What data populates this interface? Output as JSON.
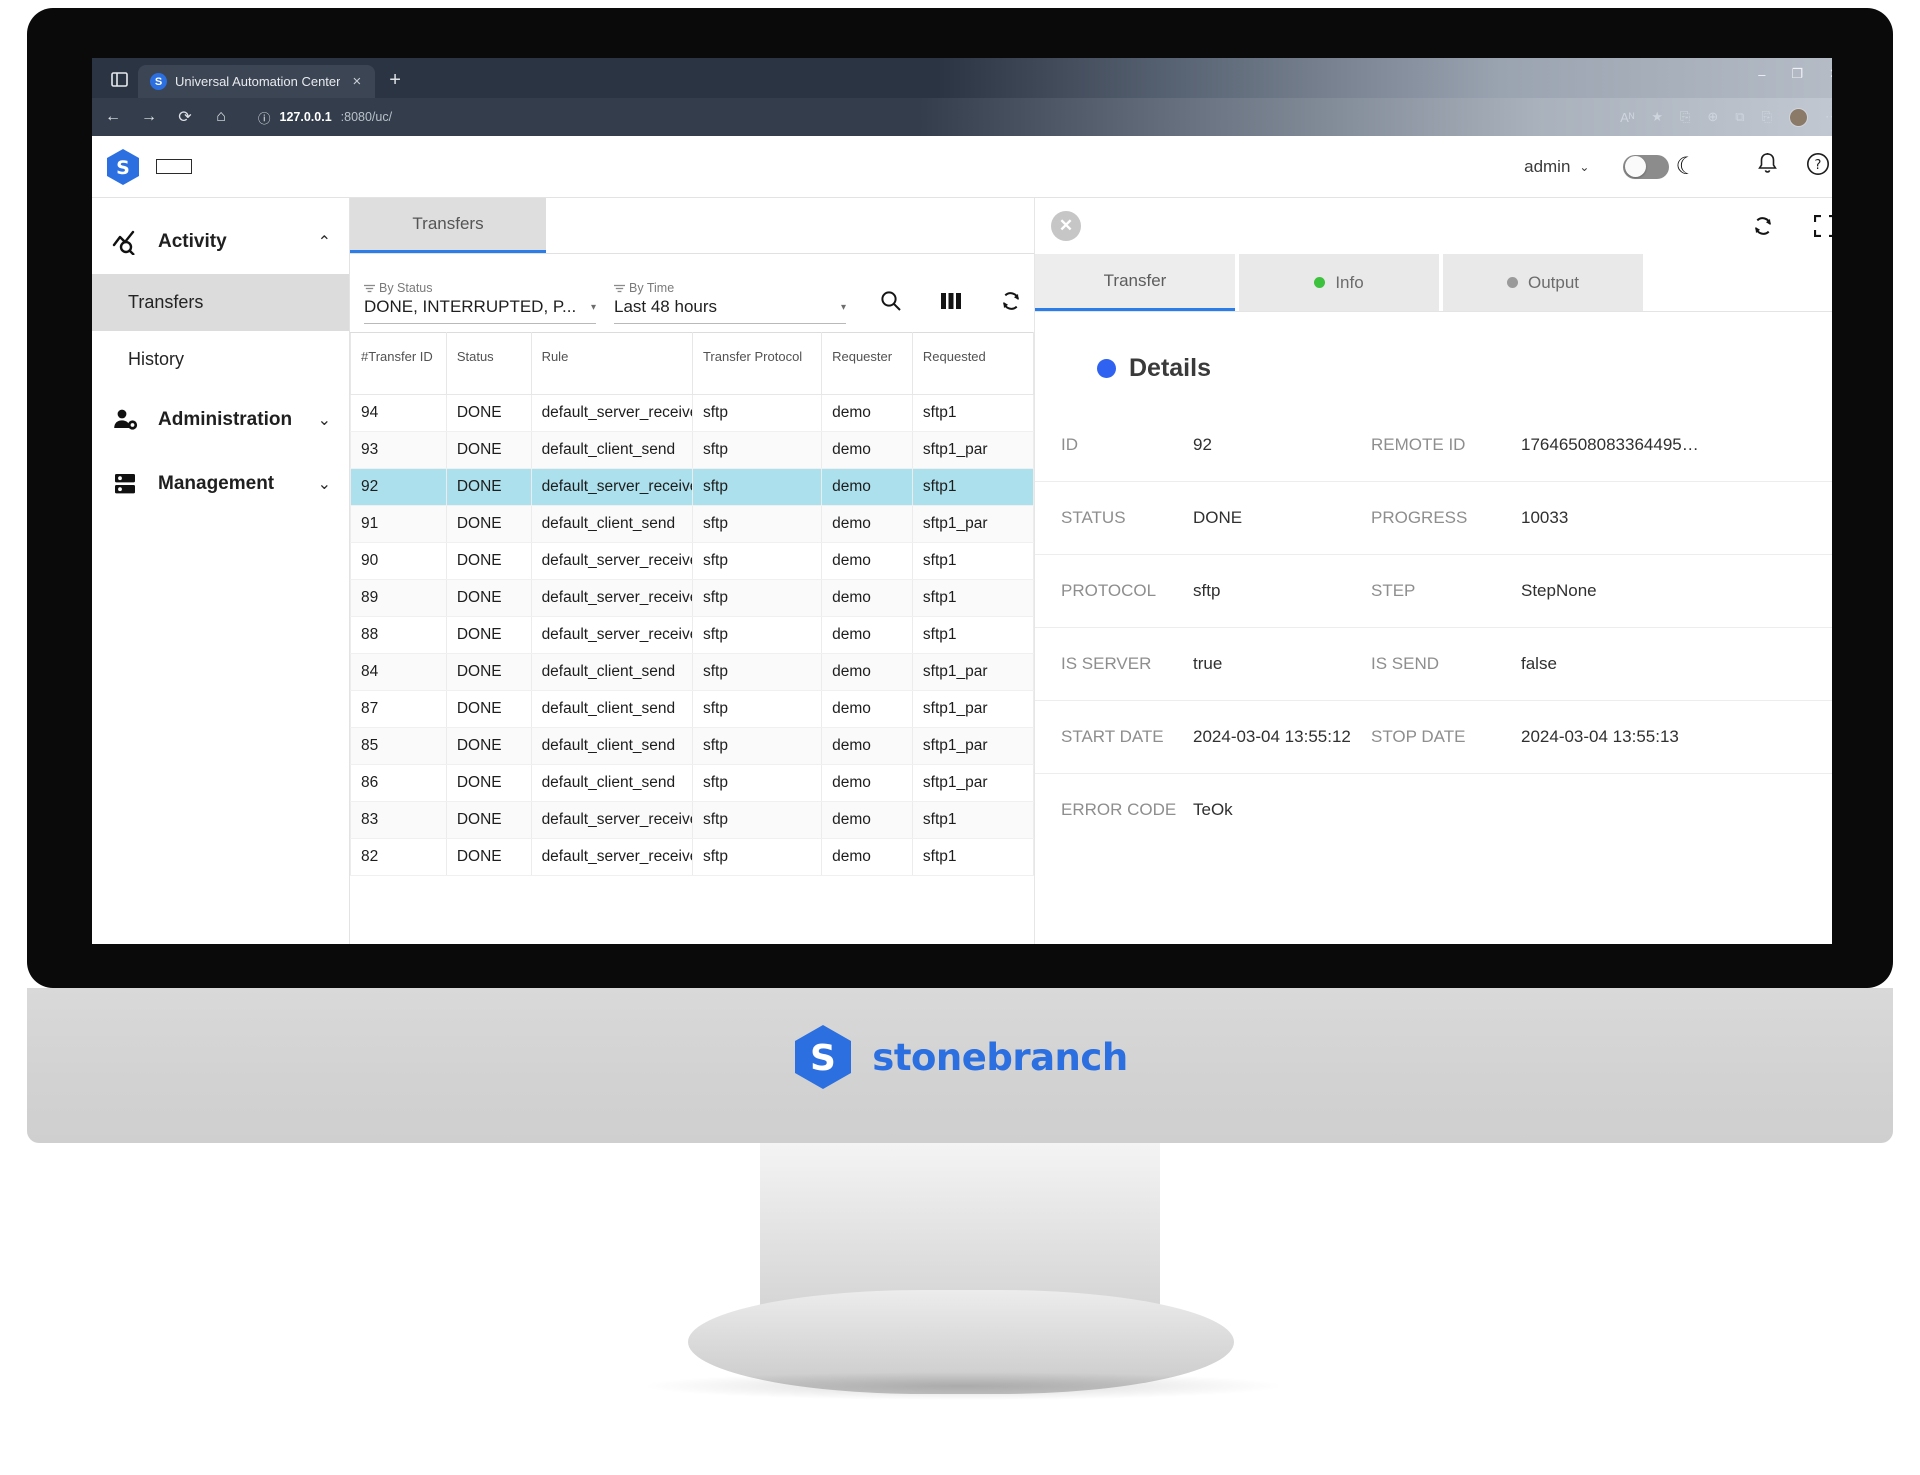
{
  "browser": {
    "tab_title": "Universal Automation Center",
    "favicon_letter": "S",
    "tab_close": "×",
    "new_tab": "+",
    "window_minimize": "–",
    "window_maximize": "❐",
    "window_close": "✕",
    "back": "←",
    "forward": "→",
    "reload": "⟳",
    "home": "⌂",
    "info_icon": "ⓘ",
    "url_host": "127.0.0.1",
    "url_rest": ":8080/uc/",
    "read_aloud": "Aᴺ",
    "favorite": "★",
    "collections": "⎘",
    "browser_essentials": "⊕",
    "split_screen": "⧉",
    "more": "⋯"
  },
  "app_header": {
    "logo_letter": "S",
    "user": "admin",
    "user_chevron": "⌄",
    "theme_moon": "☾",
    "bell_icon": "bell-icon",
    "help_icon": "?"
  },
  "sidebar": {
    "groups": [
      {
        "label": "Activity",
        "icon": "activity-icon",
        "chevron": "⌃",
        "expanded": true
      },
      {
        "label": "Administration",
        "icon": "administration-icon",
        "chevron": "⌄",
        "expanded": false
      },
      {
        "label": "Management",
        "icon": "management-icon",
        "chevron": "⌄",
        "expanded": false
      }
    ],
    "activity_items": [
      {
        "label": "Transfers",
        "active": true
      },
      {
        "label": "History",
        "active": false
      }
    ]
  },
  "page_tabs": [
    {
      "label": "Transfers",
      "active": true
    }
  ],
  "filters": {
    "by_status_label": "By Status",
    "by_status_value": "DONE, INTERRUPTED, P...",
    "by_time_label": "By Time",
    "by_time_value": "Last 48 hours",
    "caret": "▾"
  },
  "grid_toolbar": [
    {
      "name": "search-icon",
      "glyph": "⚲"
    },
    {
      "name": "columns-icon",
      "glyph": "columns"
    },
    {
      "name": "refresh-icon",
      "glyph": "refresh"
    },
    {
      "name": "fullscreen-icon",
      "glyph": "fullscreen"
    }
  ],
  "grid": {
    "columns": [
      "#Transfer ID",
      "Status",
      "Rule",
      "Transfer Protocol",
      "Requester",
      "Requested"
    ],
    "rows": [
      {
        "id": "94",
        "status": "DONE",
        "rule": "default_server_receive",
        "protocol": "sftp",
        "requester": "demo",
        "requested": "sftp1"
      },
      {
        "id": "93",
        "status": "DONE",
        "rule": "default_client_send",
        "protocol": "sftp",
        "requester": "demo",
        "requested": "sftp1_par"
      },
      {
        "id": "92",
        "status": "DONE",
        "rule": "default_server_receive",
        "protocol": "sftp",
        "requester": "demo",
        "requested": "sftp1"
      },
      {
        "id": "91",
        "status": "DONE",
        "rule": "default_client_send",
        "protocol": "sftp",
        "requester": "demo",
        "requested": "sftp1_par"
      },
      {
        "id": "90",
        "status": "DONE",
        "rule": "default_server_receive",
        "protocol": "sftp",
        "requester": "demo",
        "requested": "sftp1"
      },
      {
        "id": "89",
        "status": "DONE",
        "rule": "default_server_receive",
        "protocol": "sftp",
        "requester": "demo",
        "requested": "sftp1"
      },
      {
        "id": "88",
        "status": "DONE",
        "rule": "default_server_receive",
        "protocol": "sftp",
        "requester": "demo",
        "requested": "sftp1"
      },
      {
        "id": "84",
        "status": "DONE",
        "rule": "default_client_send",
        "protocol": "sftp",
        "requester": "demo",
        "requested": "sftp1_par"
      },
      {
        "id": "87",
        "status": "DONE",
        "rule": "default_client_send",
        "protocol": "sftp",
        "requester": "demo",
        "requested": "sftp1_par"
      },
      {
        "id": "85",
        "status": "DONE",
        "rule": "default_client_send",
        "protocol": "sftp",
        "requester": "demo",
        "requested": "sftp1_par"
      },
      {
        "id": "86",
        "status": "DONE",
        "rule": "default_client_send",
        "protocol": "sftp",
        "requester": "demo",
        "requested": "sftp1_par"
      },
      {
        "id": "83",
        "status": "DONE",
        "rule": "default_server_receive",
        "protocol": "sftp",
        "requester": "demo",
        "requested": "sftp1"
      },
      {
        "id": "82",
        "status": "DONE",
        "rule": "default_server_receive",
        "protocol": "sftp",
        "requester": "demo",
        "requested": "sftp1"
      }
    ],
    "selected_row_index": 2
  },
  "detail": {
    "close_glyph": "✕",
    "tabs": [
      {
        "label": "Transfer",
        "dot": null,
        "active": true
      },
      {
        "label": "Info",
        "dot": "#3cc23c",
        "active": false
      },
      {
        "label": "Output",
        "dot": "#9a9a9a",
        "active": false
      }
    ],
    "section_title": "Details",
    "rows": [
      {
        "k1": "ID",
        "v1": "92",
        "k2": "REMOTE ID",
        "v2": "17646508083364495…"
      },
      {
        "k1": "STATUS",
        "v1": "DONE",
        "k2": "PROGRESS",
        "v2": "10033"
      },
      {
        "k1": "PROTOCOL",
        "v1": "sftp",
        "k2": "STEP",
        "v2": "StepNone"
      },
      {
        "k1": "IS SERVER",
        "v1": "true",
        "k2": "IS SEND",
        "v2": "false"
      },
      {
        "k1": "START DATE",
        "v1": "2024-03-04 13:55:12",
        "k2": "STOP DATE",
        "v2": "2024-03-04 13:55:13"
      },
      {
        "k1": "ERROR CODE",
        "v1": "TeOk",
        "k2": "",
        "v2": ""
      }
    ]
  },
  "brand": {
    "name": "stonebranch",
    "logo_letter": "S",
    "accent": "#2b6fe0"
  }
}
